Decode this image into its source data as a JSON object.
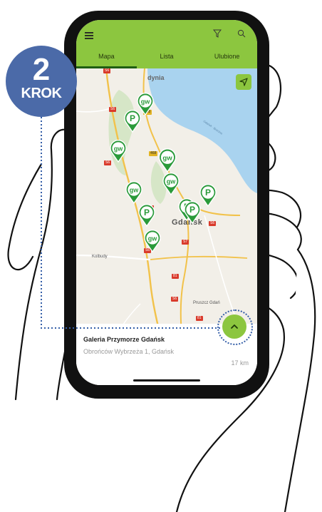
{
  "step": {
    "number": "2",
    "word": "KROK"
  },
  "app": {
    "tabs": [
      {
        "label": "Mapa",
        "active": true
      },
      {
        "label": "Lista",
        "active": false
      },
      {
        "label": "Ulubione",
        "active": false
      }
    ],
    "icons": {
      "menu": "menu-icon",
      "filter": "filter-icon",
      "search": "search-icon",
      "location": "navigation-arrow-icon",
      "expand": "chevron-up-icon"
    },
    "accent_color": "#8cc63f"
  },
  "map": {
    "labels": {
      "gdynia": "dynia",
      "gdansk": "Gdańsk",
      "kolbudy": "Kolbudy",
      "pruszcz": "Pruszcz Gdań",
      "sopot": "Gdańsk · Brzeźno"
    },
    "road_signs": [
      "S6",
      "S6",
      "468",
      "468",
      "S6",
      "S6",
      "S7",
      "S6",
      "81",
      "S6",
      "81",
      "S6"
    ],
    "pins": [
      {
        "type": "brand",
        "label": "gw"
      },
      {
        "type": "parking",
        "label": "P"
      },
      {
        "type": "brand",
        "label": "gw"
      },
      {
        "type": "brand",
        "label": "gw"
      },
      {
        "type": "brand",
        "label": "gw"
      },
      {
        "type": "brand",
        "label": "gw"
      },
      {
        "type": "parking",
        "label": "P"
      },
      {
        "type": "parking",
        "label": "P"
      },
      {
        "type": "parking",
        "label": "P"
      },
      {
        "type": "parking",
        "label": "P"
      },
      {
        "type": "brand",
        "label": "gw"
      }
    ]
  },
  "selected_place": {
    "name": "Galeria Przymorze Gdańsk",
    "address": "Obrońców Wybrzeża 1, Gdańsk",
    "distance": "17 km"
  }
}
